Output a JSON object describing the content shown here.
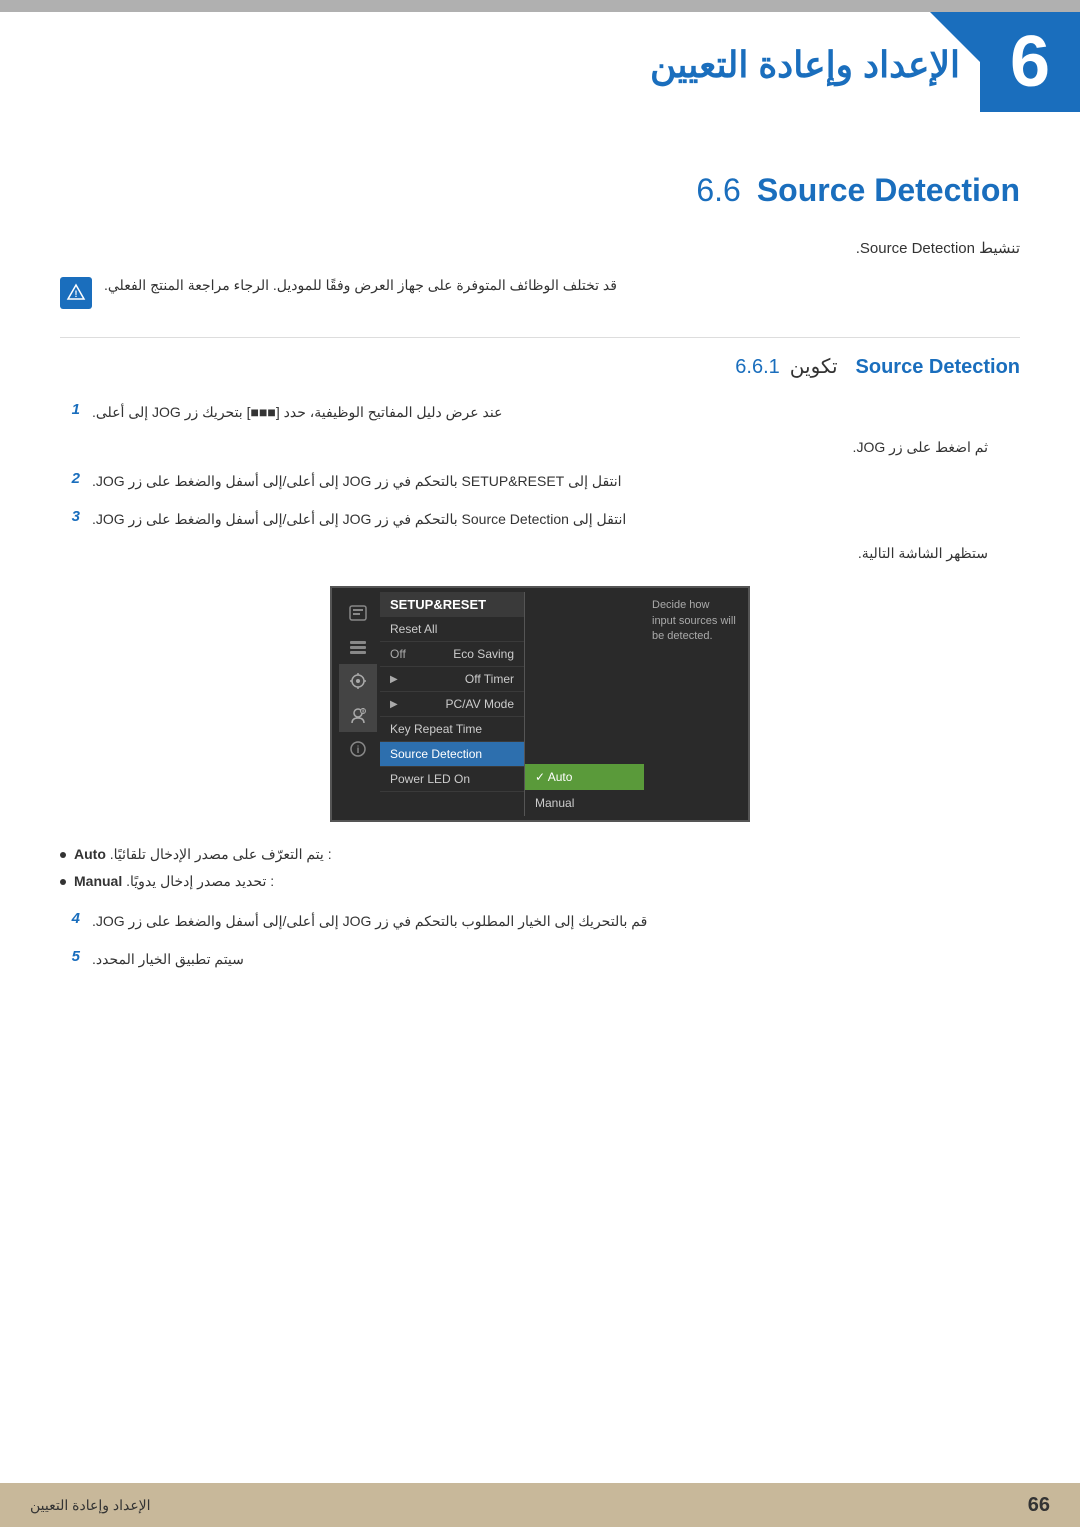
{
  "header": {
    "arabic_title": "الإعداد وإعادة التعيين",
    "chapter_number": "6"
  },
  "section": {
    "title": "Source Detection",
    "number": "6.6",
    "subsection_number": "6.6.1",
    "subsection_label": "تكوين",
    "subsection_title": "Source Detection"
  },
  "activation_text": "تنشيط Source Detection.",
  "warning_text": "قد تختلف الوظائف المتوفرة على جهاز العرض وفقًا للموديل. الرجاء مراجعة المنتج الفعلي.",
  "steps": [
    {
      "number": "1",
      "line1": "عند عرض دليل المفاتيح الوظيفية، حدد [■■■] بتحريك زر JOG إلى أعلى.",
      "line2": "ثم اضغط على زر JOG."
    },
    {
      "number": "2",
      "line1": "انتقل إلى SETUP&RESET بالتحكم في زر JOG إلى أعلى/إلى أسفل والضغط على زر JOG."
    },
    {
      "number": "3",
      "line1": "انتقل إلى Source Detection بالتحكم في زر JOG إلى أعلى/إلى أسفل والضغط على زر JOG.",
      "line2": "ستظهر الشاشة التالية."
    },
    {
      "number": "4",
      "line1": "قم بالتحريك إلى الخيار المطلوب بالتحكم في زر JOG إلى أعلى/إلى أسفل والضغط على زر JOG."
    },
    {
      "number": "5",
      "line1": "سيتم تطبيق الخيار المحدد."
    }
  ],
  "menu": {
    "header": "SETUP&RESET",
    "items": [
      {
        "label": "Reset All",
        "value": "",
        "arrow": false
      },
      {
        "label": "Eco Saving",
        "value": "Off",
        "arrow": false
      },
      {
        "label": "Off Timer",
        "value": "",
        "arrow": true
      },
      {
        "label": "PC/AV Mode",
        "value": "",
        "arrow": true
      },
      {
        "label": "Key Repeat Time",
        "value": "",
        "arrow": false
      },
      {
        "label": "Source Detection",
        "value": "",
        "arrow": false,
        "highlighted": true
      },
      {
        "label": "Power LED On",
        "value": "",
        "arrow": false
      }
    ],
    "submenu": [
      {
        "label": "✓ Auto",
        "active": true
      },
      {
        "label": "Manual",
        "active": false
      }
    ],
    "tooltip": "Decide how input sources will be detected."
  },
  "bullets": [
    {
      "label": "Auto",
      "text": ": يتم التعرّف على مصدر الإدخال تلقائيًا."
    },
    {
      "label": "Manual",
      "text": ": تحديد مصدر إدخال يدويًا."
    }
  ],
  "footer": {
    "text": "الإعداد وإعادة التعيين",
    "page": "66"
  }
}
